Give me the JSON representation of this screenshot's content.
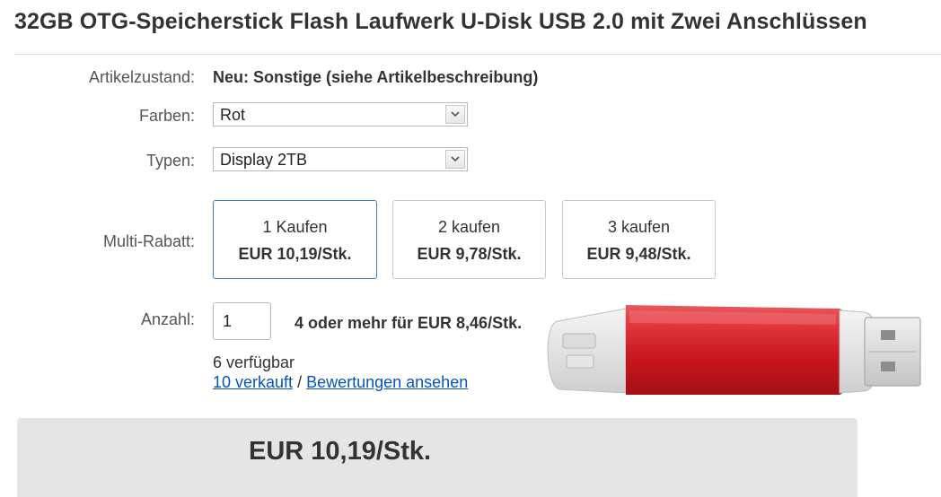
{
  "title": "32GB OTG-Speicherstick Flash Laufwerk U-Disk USB 2.0 mit Zwei Anschlüssen",
  "condition": {
    "label": "Artikelzustand:",
    "value": "Neu: Sonstige (siehe Artikelbeschreibung)"
  },
  "colors": {
    "label": "Farben:",
    "selected": "Rot"
  },
  "types": {
    "label": "Typen:",
    "selected": "Display 2TB"
  },
  "multi_discount": {
    "label": "Multi-Rabatt:",
    "tiers": [
      {
        "qty_label": "1 Kaufen",
        "price": "EUR 10,19/Stk.",
        "selected": true
      },
      {
        "qty_label": "2 kaufen",
        "price": "EUR 9,78/Stk.",
        "selected": false
      },
      {
        "qty_label": "3 kaufen",
        "price": "EUR 9,48/Stk.",
        "selected": false
      }
    ]
  },
  "quantity": {
    "label": "Anzahl:",
    "value": "1",
    "bulk_note": "4 oder mehr für EUR 8,46/Stk.",
    "available": "6 verfügbar",
    "sold_link": "10 verkauft",
    "separator": " / ",
    "reviews_link": "Bewertungen ansehen"
  },
  "price_panel": {
    "price": "EUR 10,19/Stk."
  },
  "colors_hex": {
    "link": "#0654ba",
    "selected_border": "#3d7fc4",
    "panel_bg": "#e5e5e5",
    "product_red": "#d9262c"
  },
  "icons": {
    "dropdown": "chevron-down-icon"
  }
}
